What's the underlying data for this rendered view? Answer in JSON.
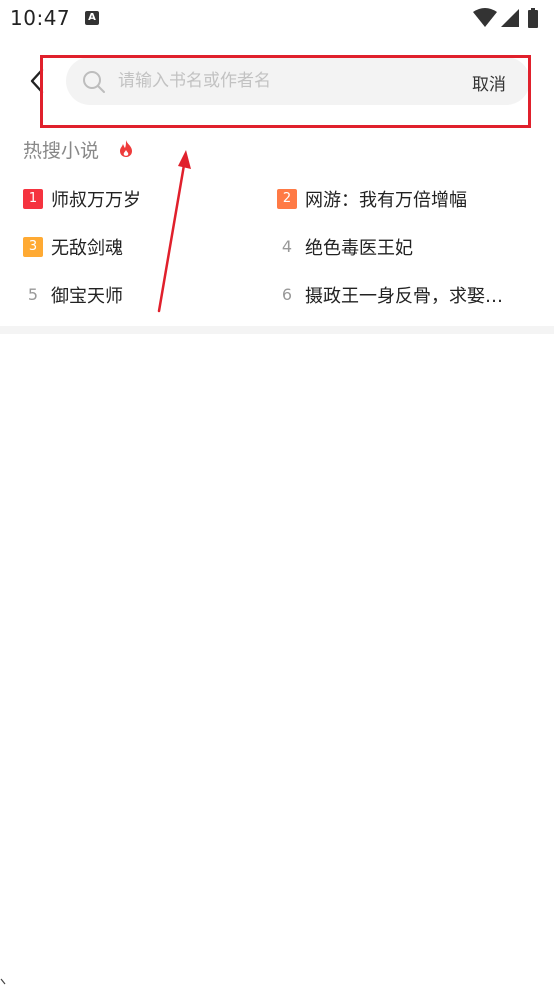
{
  "status_bar": {
    "time": "10:47",
    "notification_glyph": "A",
    "icons": [
      "wifi-icon",
      "signal-icon",
      "battery-icon"
    ]
  },
  "header": {
    "back_icon": "chevron-left-icon",
    "search": {
      "placeholder": "请输入书名或作者名",
      "value": "",
      "icon": "search-icon"
    },
    "cancel_label": "取消"
  },
  "hot_search": {
    "title": "热搜小说",
    "title_icon": "fire-icon",
    "items": [
      {
        "rank": "1",
        "name": "师叔万万岁",
        "badge_color": "#f5333f"
      },
      {
        "rank": "2",
        "name": "网游：我有万倍增幅",
        "badge_color": "#ff7a45"
      },
      {
        "rank": "3",
        "name": "无敌剑魂",
        "badge_color": "#ffaa33"
      },
      {
        "rank": "4",
        "name": "绝色毒医王妃",
        "badge_color": ""
      },
      {
        "rank": "5",
        "name": "御宝天师",
        "badge_color": ""
      },
      {
        "rank": "6",
        "name": "摄政王一身反骨，求娶…",
        "badge_color": ""
      }
    ]
  },
  "annotation": {
    "highlight_color": "#e0202c"
  }
}
